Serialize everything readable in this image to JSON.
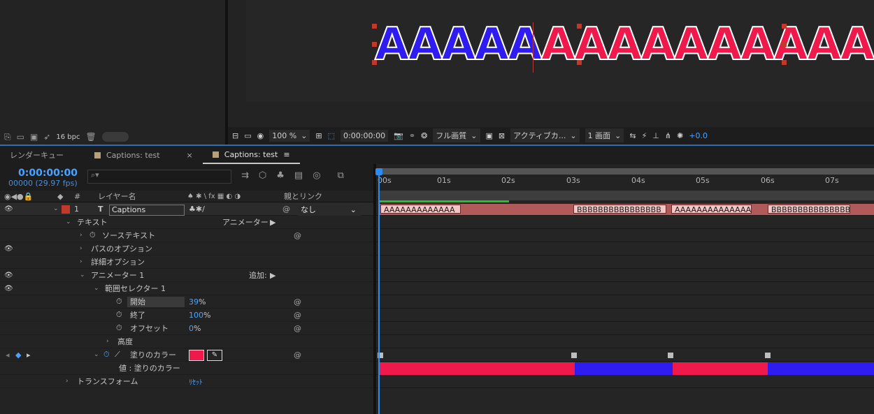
{
  "project_toolbar": {
    "bpc": "16 bpc"
  },
  "composition": {
    "text_blue": "AAAAA",
    "text_red": "AAAAAAAAAA"
  },
  "viewer_toolbar": {
    "zoom": "100 %",
    "timecode": "0:00:00:00",
    "resolution": "フル画質",
    "camera": "アクティブカ...",
    "views": "1 画面",
    "exposure": "+0.0"
  },
  "tabs": [
    {
      "label": "レンダーキュー"
    },
    {
      "label": "Captions: test"
    },
    {
      "label": "Captions: test"
    }
  ],
  "timeline": {
    "timecode": "0:00:00:00",
    "fps": "00000 (29.97 fps)",
    "search_placeholder": "",
    "columns": {
      "hash": "#",
      "layer_name": "レイヤー名",
      "switches": "♠ ✱ \\ fx ▦ ◐ ◑",
      "parent": "親とリンク"
    },
    "ruler_ticks": [
      "00s",
      "01s",
      "02s",
      "03s",
      "04s",
      "05s",
      "06s",
      "07s"
    ]
  },
  "layers": {
    "layer1": {
      "index": "1",
      "type_icon": "T",
      "name": "Captions",
      "parent": "なし"
    },
    "text": "テキスト",
    "animator_label": "アニメーター :",
    "source_text": "ソーステキスト",
    "path_options": "パスのオプション",
    "more_options": "詳細オプション",
    "animator1": "アニメーター 1",
    "add_label": "追加:",
    "range_selector": "範囲セレクター 1",
    "start": {
      "label": "開始",
      "value": "39",
      "unit": "%"
    },
    "end": {
      "label": "終了",
      "value": "100",
      "unit": "%"
    },
    "offset": {
      "label": "オフセット",
      "value": "0",
      "unit": "%"
    },
    "advanced": "高度",
    "fill_color": "塗りのカラー",
    "value_fill": "値 : 塗りのカラー",
    "transform": "トランスフォーム",
    "reset": "ﾘｾｯﾄ"
  },
  "track": {
    "segments": [
      "AAAAAAAAAAAAA",
      "BBBBBBBBBBBBBBBB",
      "AAAAAAAAAAAAAA",
      "BBBBBBBBBBBBBBB"
    ],
    "color_bars": [
      "#ef1a4b",
      "#2f1cf0",
      "#ef1a4b",
      "#2f1cf0"
    ]
  },
  "colors": {
    "accent_blue": "#4aa3ff",
    "fill_red": "#ef1a4b",
    "fill_blue": "#2f1cf0"
  }
}
